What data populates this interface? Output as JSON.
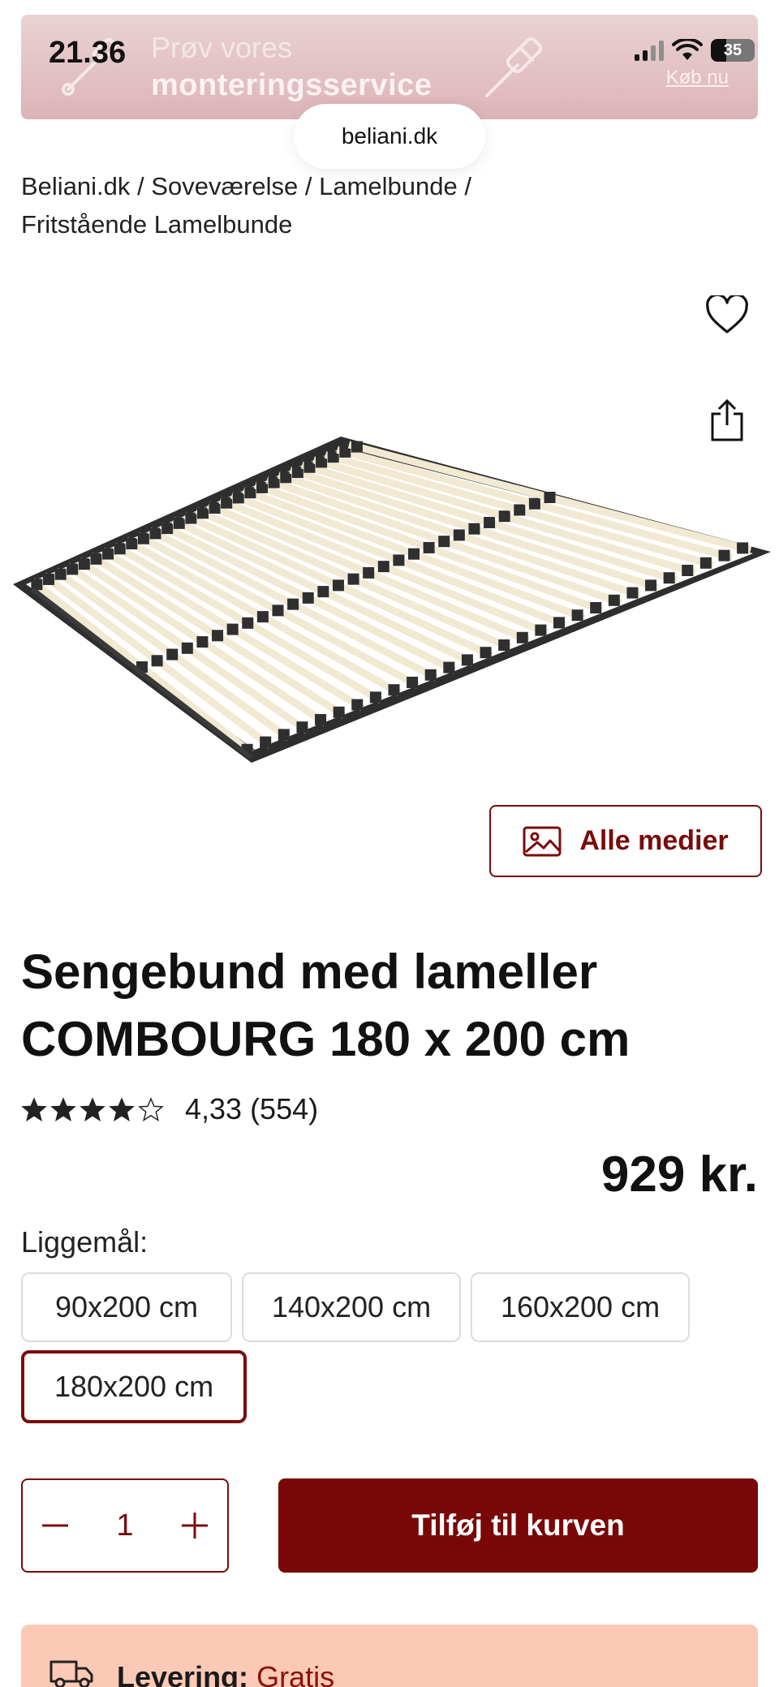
{
  "status_bar": {
    "time": "21.36",
    "battery": "35"
  },
  "promo": {
    "line1": "Prøv vores",
    "line2": "monteringsservice",
    "cta": "Køb nu"
  },
  "browser": {
    "url": "beliani.dk"
  },
  "breadcrumb": {
    "items": [
      "Beliani.dk",
      "Soveværelse",
      "Lamelbunde",
      "Fritstående Lamelbunde"
    ],
    "separator": "/"
  },
  "gallery": {
    "all_media_label": "Alle medier"
  },
  "product": {
    "title": "Sengebund med lameller COMBOURG 180 x 200 cm",
    "rating": 4.33,
    "rating_text": "4,33 (554)",
    "price": "929 kr."
  },
  "sizes": {
    "label": "Liggemål:",
    "options": [
      "90x200 cm",
      "140x200 cm",
      "160x200 cm",
      "180x200 cm"
    ],
    "selected": "180x200 cm"
  },
  "cart": {
    "quantity": "1",
    "add_label": "Tilføj til kurven"
  },
  "delivery": {
    "label": "Levering:",
    "value": "Gratis"
  },
  "colors": {
    "brand": "#7a0707",
    "accent_text": "#7a0c0c",
    "promo_bg": "#dcb4b8",
    "delivery_bg": "#fbc9b6"
  },
  "icons": [
    "screwdriver-icon",
    "heart-icon",
    "share-icon",
    "image-icon",
    "star-icon",
    "minus-icon",
    "plus-icon",
    "truck-icon"
  ]
}
